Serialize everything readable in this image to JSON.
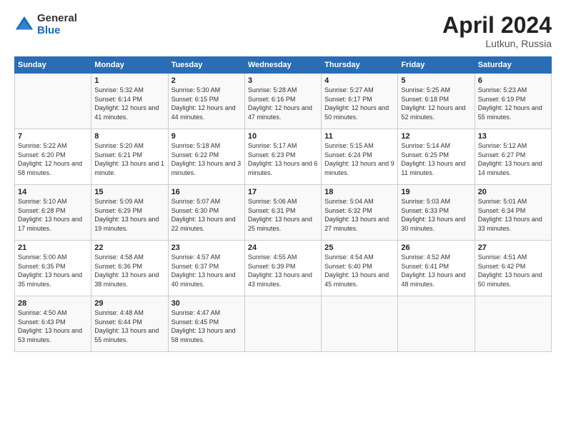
{
  "logo": {
    "general": "General",
    "blue": "Blue"
  },
  "title": "April 2024",
  "location": "Lutkun, Russia",
  "days_of_week": [
    "Sunday",
    "Monday",
    "Tuesday",
    "Wednesday",
    "Thursday",
    "Friday",
    "Saturday"
  ],
  "weeks": [
    [
      {
        "day": "",
        "sunrise": "",
        "sunset": "",
        "daylight": ""
      },
      {
        "day": "1",
        "sunrise": "Sunrise: 5:32 AM",
        "sunset": "Sunset: 6:14 PM",
        "daylight": "Daylight: 12 hours and 41 minutes."
      },
      {
        "day": "2",
        "sunrise": "Sunrise: 5:30 AM",
        "sunset": "Sunset: 6:15 PM",
        "daylight": "Daylight: 12 hours and 44 minutes."
      },
      {
        "day": "3",
        "sunrise": "Sunrise: 5:28 AM",
        "sunset": "Sunset: 6:16 PM",
        "daylight": "Daylight: 12 hours and 47 minutes."
      },
      {
        "day": "4",
        "sunrise": "Sunrise: 5:27 AM",
        "sunset": "Sunset: 6:17 PM",
        "daylight": "Daylight: 12 hours and 50 minutes."
      },
      {
        "day": "5",
        "sunrise": "Sunrise: 5:25 AM",
        "sunset": "Sunset: 6:18 PM",
        "daylight": "Daylight: 12 hours and 52 minutes."
      },
      {
        "day": "6",
        "sunrise": "Sunrise: 5:23 AM",
        "sunset": "Sunset: 6:19 PM",
        "daylight": "Daylight: 12 hours and 55 minutes."
      }
    ],
    [
      {
        "day": "7",
        "sunrise": "Sunrise: 5:22 AM",
        "sunset": "Sunset: 6:20 PM",
        "daylight": "Daylight: 12 hours and 58 minutes."
      },
      {
        "day": "8",
        "sunrise": "Sunrise: 5:20 AM",
        "sunset": "Sunset: 6:21 PM",
        "daylight": "Daylight: 13 hours and 1 minute."
      },
      {
        "day": "9",
        "sunrise": "Sunrise: 5:18 AM",
        "sunset": "Sunset: 6:22 PM",
        "daylight": "Daylight: 13 hours and 3 minutes."
      },
      {
        "day": "10",
        "sunrise": "Sunrise: 5:17 AM",
        "sunset": "Sunset: 6:23 PM",
        "daylight": "Daylight: 13 hours and 6 minutes."
      },
      {
        "day": "11",
        "sunrise": "Sunrise: 5:15 AM",
        "sunset": "Sunset: 6:24 PM",
        "daylight": "Daylight: 13 hours and 9 minutes."
      },
      {
        "day": "12",
        "sunrise": "Sunrise: 5:14 AM",
        "sunset": "Sunset: 6:25 PM",
        "daylight": "Daylight: 13 hours and 11 minutes."
      },
      {
        "day": "13",
        "sunrise": "Sunrise: 5:12 AM",
        "sunset": "Sunset: 6:27 PM",
        "daylight": "Daylight: 13 hours and 14 minutes."
      }
    ],
    [
      {
        "day": "14",
        "sunrise": "Sunrise: 5:10 AM",
        "sunset": "Sunset: 6:28 PM",
        "daylight": "Daylight: 13 hours and 17 minutes."
      },
      {
        "day": "15",
        "sunrise": "Sunrise: 5:09 AM",
        "sunset": "Sunset: 6:29 PM",
        "daylight": "Daylight: 13 hours and 19 minutes."
      },
      {
        "day": "16",
        "sunrise": "Sunrise: 5:07 AM",
        "sunset": "Sunset: 6:30 PM",
        "daylight": "Daylight: 13 hours and 22 minutes."
      },
      {
        "day": "17",
        "sunrise": "Sunrise: 5:06 AM",
        "sunset": "Sunset: 6:31 PM",
        "daylight": "Daylight: 13 hours and 25 minutes."
      },
      {
        "day": "18",
        "sunrise": "Sunrise: 5:04 AM",
        "sunset": "Sunset: 6:32 PM",
        "daylight": "Daylight: 13 hours and 27 minutes."
      },
      {
        "day": "19",
        "sunrise": "Sunrise: 5:03 AM",
        "sunset": "Sunset: 6:33 PM",
        "daylight": "Daylight: 13 hours and 30 minutes."
      },
      {
        "day": "20",
        "sunrise": "Sunrise: 5:01 AM",
        "sunset": "Sunset: 6:34 PM",
        "daylight": "Daylight: 13 hours and 33 minutes."
      }
    ],
    [
      {
        "day": "21",
        "sunrise": "Sunrise: 5:00 AM",
        "sunset": "Sunset: 6:35 PM",
        "daylight": "Daylight: 13 hours and 35 minutes."
      },
      {
        "day": "22",
        "sunrise": "Sunrise: 4:58 AM",
        "sunset": "Sunset: 6:36 PM",
        "daylight": "Daylight: 13 hours and 38 minutes."
      },
      {
        "day": "23",
        "sunrise": "Sunrise: 4:57 AM",
        "sunset": "Sunset: 6:37 PM",
        "daylight": "Daylight: 13 hours and 40 minutes."
      },
      {
        "day": "24",
        "sunrise": "Sunrise: 4:55 AM",
        "sunset": "Sunset: 6:39 PM",
        "daylight": "Daylight: 13 hours and 43 minutes."
      },
      {
        "day": "25",
        "sunrise": "Sunrise: 4:54 AM",
        "sunset": "Sunset: 6:40 PM",
        "daylight": "Daylight: 13 hours and 45 minutes."
      },
      {
        "day": "26",
        "sunrise": "Sunrise: 4:52 AM",
        "sunset": "Sunset: 6:41 PM",
        "daylight": "Daylight: 13 hours and 48 minutes."
      },
      {
        "day": "27",
        "sunrise": "Sunrise: 4:51 AM",
        "sunset": "Sunset: 6:42 PM",
        "daylight": "Daylight: 13 hours and 50 minutes."
      }
    ],
    [
      {
        "day": "28",
        "sunrise": "Sunrise: 4:50 AM",
        "sunset": "Sunset: 6:43 PM",
        "daylight": "Daylight: 13 hours and 53 minutes."
      },
      {
        "day": "29",
        "sunrise": "Sunrise: 4:48 AM",
        "sunset": "Sunset: 6:44 PM",
        "daylight": "Daylight: 13 hours and 55 minutes."
      },
      {
        "day": "30",
        "sunrise": "Sunrise: 4:47 AM",
        "sunset": "Sunset: 6:45 PM",
        "daylight": "Daylight: 13 hours and 58 minutes."
      },
      {
        "day": "",
        "sunrise": "",
        "sunset": "",
        "daylight": ""
      },
      {
        "day": "",
        "sunrise": "",
        "sunset": "",
        "daylight": ""
      },
      {
        "day": "",
        "sunrise": "",
        "sunset": "",
        "daylight": ""
      },
      {
        "day": "",
        "sunrise": "",
        "sunset": "",
        "daylight": ""
      }
    ]
  ]
}
